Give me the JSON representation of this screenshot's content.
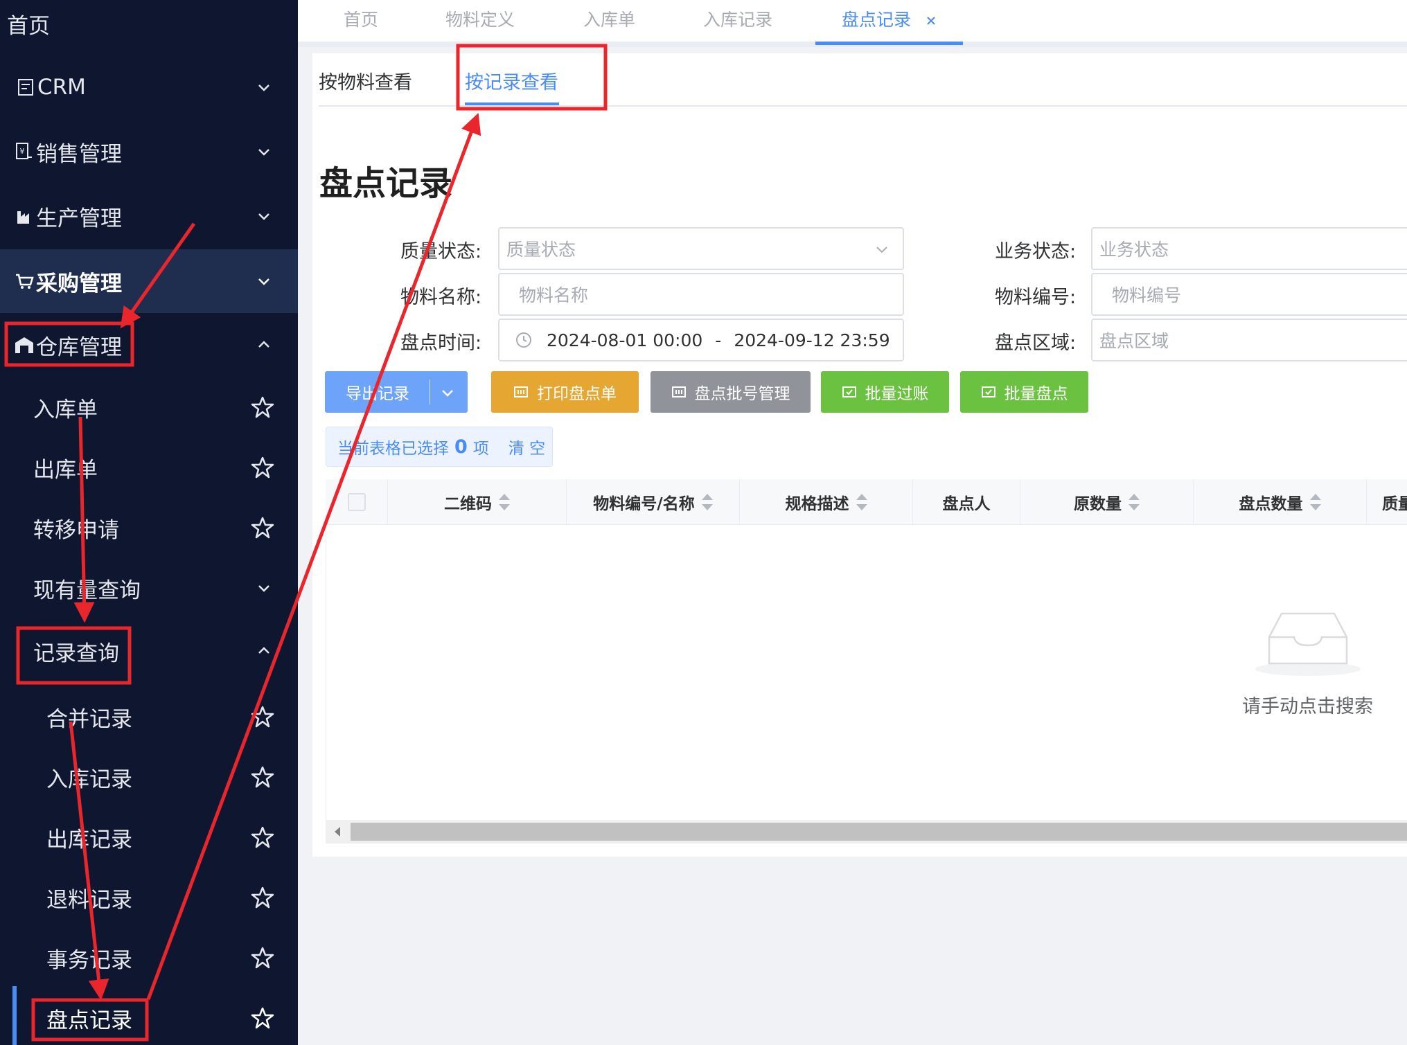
{
  "sidebar": {
    "home": "首页",
    "menus": [
      {
        "label": "CRM",
        "icon": "crm-icon"
      },
      {
        "label": "销售管理",
        "icon": "sales-icon"
      },
      {
        "label": "生产管理",
        "icon": "factory-icon"
      },
      {
        "label": "采购管理",
        "icon": "cart-icon"
      },
      {
        "label": "仓库管理",
        "icon": "warehouse-icon"
      }
    ],
    "warehouse_items": [
      "入库单",
      "出库单",
      "转移申请",
      "现有量查询",
      "记录查询"
    ],
    "record_items": [
      "合并记录",
      "入库记录",
      "出库记录",
      "退料记录",
      "事务记录",
      "盘点记录"
    ]
  },
  "top_tabs": [
    "首页",
    "物料定义",
    "入库单",
    "入库记录",
    "盘点记录"
  ],
  "sub_tabs": [
    "按物料查看",
    "按记录查看"
  ],
  "page_title": "盘点记录",
  "filters": {
    "quality_status_label": "质量状态:",
    "quality_status_placeholder": "质量状态",
    "business_status_label": "业务状态:",
    "business_status_placeholder": "业务状态",
    "material_name_label": "物料名称:",
    "material_name_placeholder": "物料名称",
    "material_code_label": "物料编号:",
    "material_code_placeholder": "物料编号",
    "count_time_label": "盘点时间:",
    "count_time_start": "2024-08-01 00:00",
    "count_time_sep": "-",
    "count_time_end": "2024-09-12 23:59",
    "count_area_label": "盘点区域:",
    "count_area_placeholder": "盘点区域"
  },
  "buttons": {
    "export": "导出记录",
    "print": "打印盘点单",
    "batch_no": "盘点批号管理",
    "batch_post": "批量过账",
    "batch_count": "批量盘点"
  },
  "selection": {
    "prefix": "当前表格已选择",
    "count": "0",
    "suffix": "项",
    "clear": "清 空"
  },
  "table": {
    "columns": [
      "二维码",
      "物料编号/名称",
      "规格描述",
      "盘点人",
      "原数量",
      "盘点数量",
      "质量"
    ],
    "empty_text": "请手动点击搜索"
  },
  "colors": {
    "sidebar_bg": "#0f1730",
    "accent": "#4a8cf7",
    "orange": "#e5a632",
    "gray": "#909399",
    "green": "#6ac240",
    "annotation": "#e8262c"
  }
}
